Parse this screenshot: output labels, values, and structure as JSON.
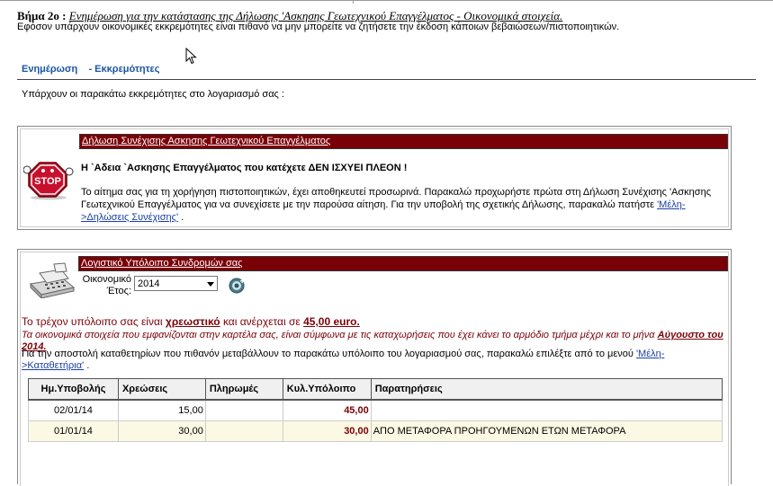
{
  "step": {
    "label": "Βήμα 2ο :",
    "title": "Ενημέρωση για την κατάστασης της Δήλωσης 'Ασκησης Γεωτεχνικού Επαγγέλματος - Οικονομικά στοιχεία."
  },
  "notice": "Εφόσον υπάρχουν οικονομικές εκκρεμότητες είναι πιθανό να μην μπορείτε να ζητήσετε την έκδοση κάποιων βεβαιώσεων/πιστοποιητικών.",
  "nav": {
    "update": "Ενημέρωση",
    "pending": "- Εκκρεμότητες"
  },
  "pending_intro": "Υπάρχουν οι παρακάτω εκκρεμότητες στο λογαριασμό σας :",
  "panel1": {
    "header": "Δήλωση Συνέχισης Ασκησης Γεωτεχνικού Επαγγέλματος",
    "title": "Η `Αδεια `Ασκησης Επαγγέλματος που κατέχετε ΔΕΝ ΙΣΧΥΕΙ ΠΛΕΟΝ !",
    "text": "Το αίτημα σας για τη χορήγηση πιστοποιητικών, έχει αποθηκευτεί προσωρινά. Παρακαλώ προχωρήστε πρώτα στη Δήλωση Συνέχισης 'Ασκησης Γεωτεχνικού Επαγγέλματος για να συνεχίσετε με την παρούσα αίτηση. Για την υποβολή της σχετικής Δήλωσης, παρακαλώ πατήστε",
    "link": "'Μέλη->Δηλώσεις Συνέχισης'",
    "text_end": ".",
    "icon": "stop-sign-icon"
  },
  "panel2": {
    "header": "Λογιστικό Υπόλοιπο Συνδρομών σας",
    "year_label": "Οικονομικό Έτος:",
    "year_value": "2014",
    "icon": "cash-register-icon",
    "balance_prefix": "Το τρέχον υπόλοιπο σας είναι",
    "balance_status": "χρεωστικό",
    "balance_mid": "και ανέρχεται σε",
    "balance_amount": "45,00 euro.",
    "info_text": "Τα οικονομικά στοιχεία που εμφανίζονται στην καρτέλα σας, είναι σύμφωνα με τις καταχωρήσεις που έχει κάνει το αρμόδιο τμήμα μέχρι και το μήνα",
    "info_month": "Αύγουστο του 2014.",
    "send_text": "Για την αποστολή καταθετηρίων που πιθανόν μεταβάλλουν το παρακάτω υπόλοιπο του λογαριασμού σας, παρακαλώ επιλέξτε από το μενού",
    "send_link": "'Μέλη->Καταθετήρια'",
    "send_end": ".",
    "table": {
      "headers": [
        "Ημ.Υποβολής",
        "Χρεώσεις",
        "Πληρωμές",
        "Κυλ.Υπόλοιπο",
        "Παρατηρήσεις"
      ],
      "rows": [
        {
          "date": "02/01/14",
          "charges": "15,00",
          "payments": "",
          "balance": "45,00",
          "notes": ""
        },
        {
          "date": "01/01/14",
          "charges": "30,00",
          "payments": "",
          "balance": "30,00",
          "notes": "ΑΠΟ ΜΕΤΑΦΟΡΑ ΠΡΟΗΓΟΥΜΕΝΩΝ ΕΤΩΝ ΜΕΤΑΦΟΡΑ"
        }
      ]
    }
  },
  "colors": {
    "header_bg": "#7a0008",
    "link": "#1a55a3",
    "alert": "#7a0008",
    "row_alt": "#fbf9e3"
  }
}
